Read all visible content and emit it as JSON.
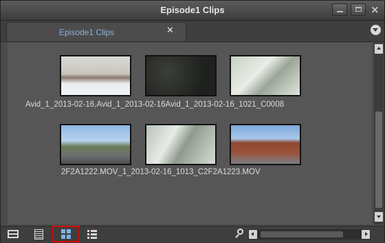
{
  "window": {
    "title": "Episode1 Clips",
    "controls": {
      "minimize": "minimize",
      "maximize": "maximize",
      "close": "×"
    }
  },
  "tabs": [
    {
      "label": "Episode1 Clips",
      "close_glyph": "✕",
      "active": true
    }
  ],
  "bin": {
    "view_mode": "frame",
    "rows": [
      {
        "caption": "Avid_1_2013-02-16,Avid_1_2013-02-16Avid_1_2013-02-16_1021_C0008",
        "clips": [
          "Avid_1_2013-02-16",
          "Avid_1_2013-02-16",
          "Avid_1_2013-02-16_1021_C0008"
        ]
      },
      {
        "caption": "2F2A1222.MOV_1_2013-02-16_1013_C2F2A1223.MOV",
        "clips": [
          "2F2A1222.MOV",
          "_1_2013-02-16_1013_C",
          "2F2A1223.MOV"
        ]
      }
    ]
  },
  "toolbar": {
    "views": [
      {
        "name": "frame-view",
        "icon": "frame-view-icon",
        "selected": false
      },
      {
        "name": "script-view",
        "icon": "script-view-icon",
        "selected": false
      },
      {
        "name": "thumbnail-view",
        "icon": "grid-icon",
        "selected": true
      },
      {
        "name": "list-view",
        "icon": "list-icon",
        "selected": false
      }
    ],
    "search_icon": "search-icon",
    "highlight_color": "#e00000"
  },
  "colors": {
    "tab_label": "#8fb0d6",
    "background": "#565656",
    "title_text": "#e6e6e6"
  }
}
